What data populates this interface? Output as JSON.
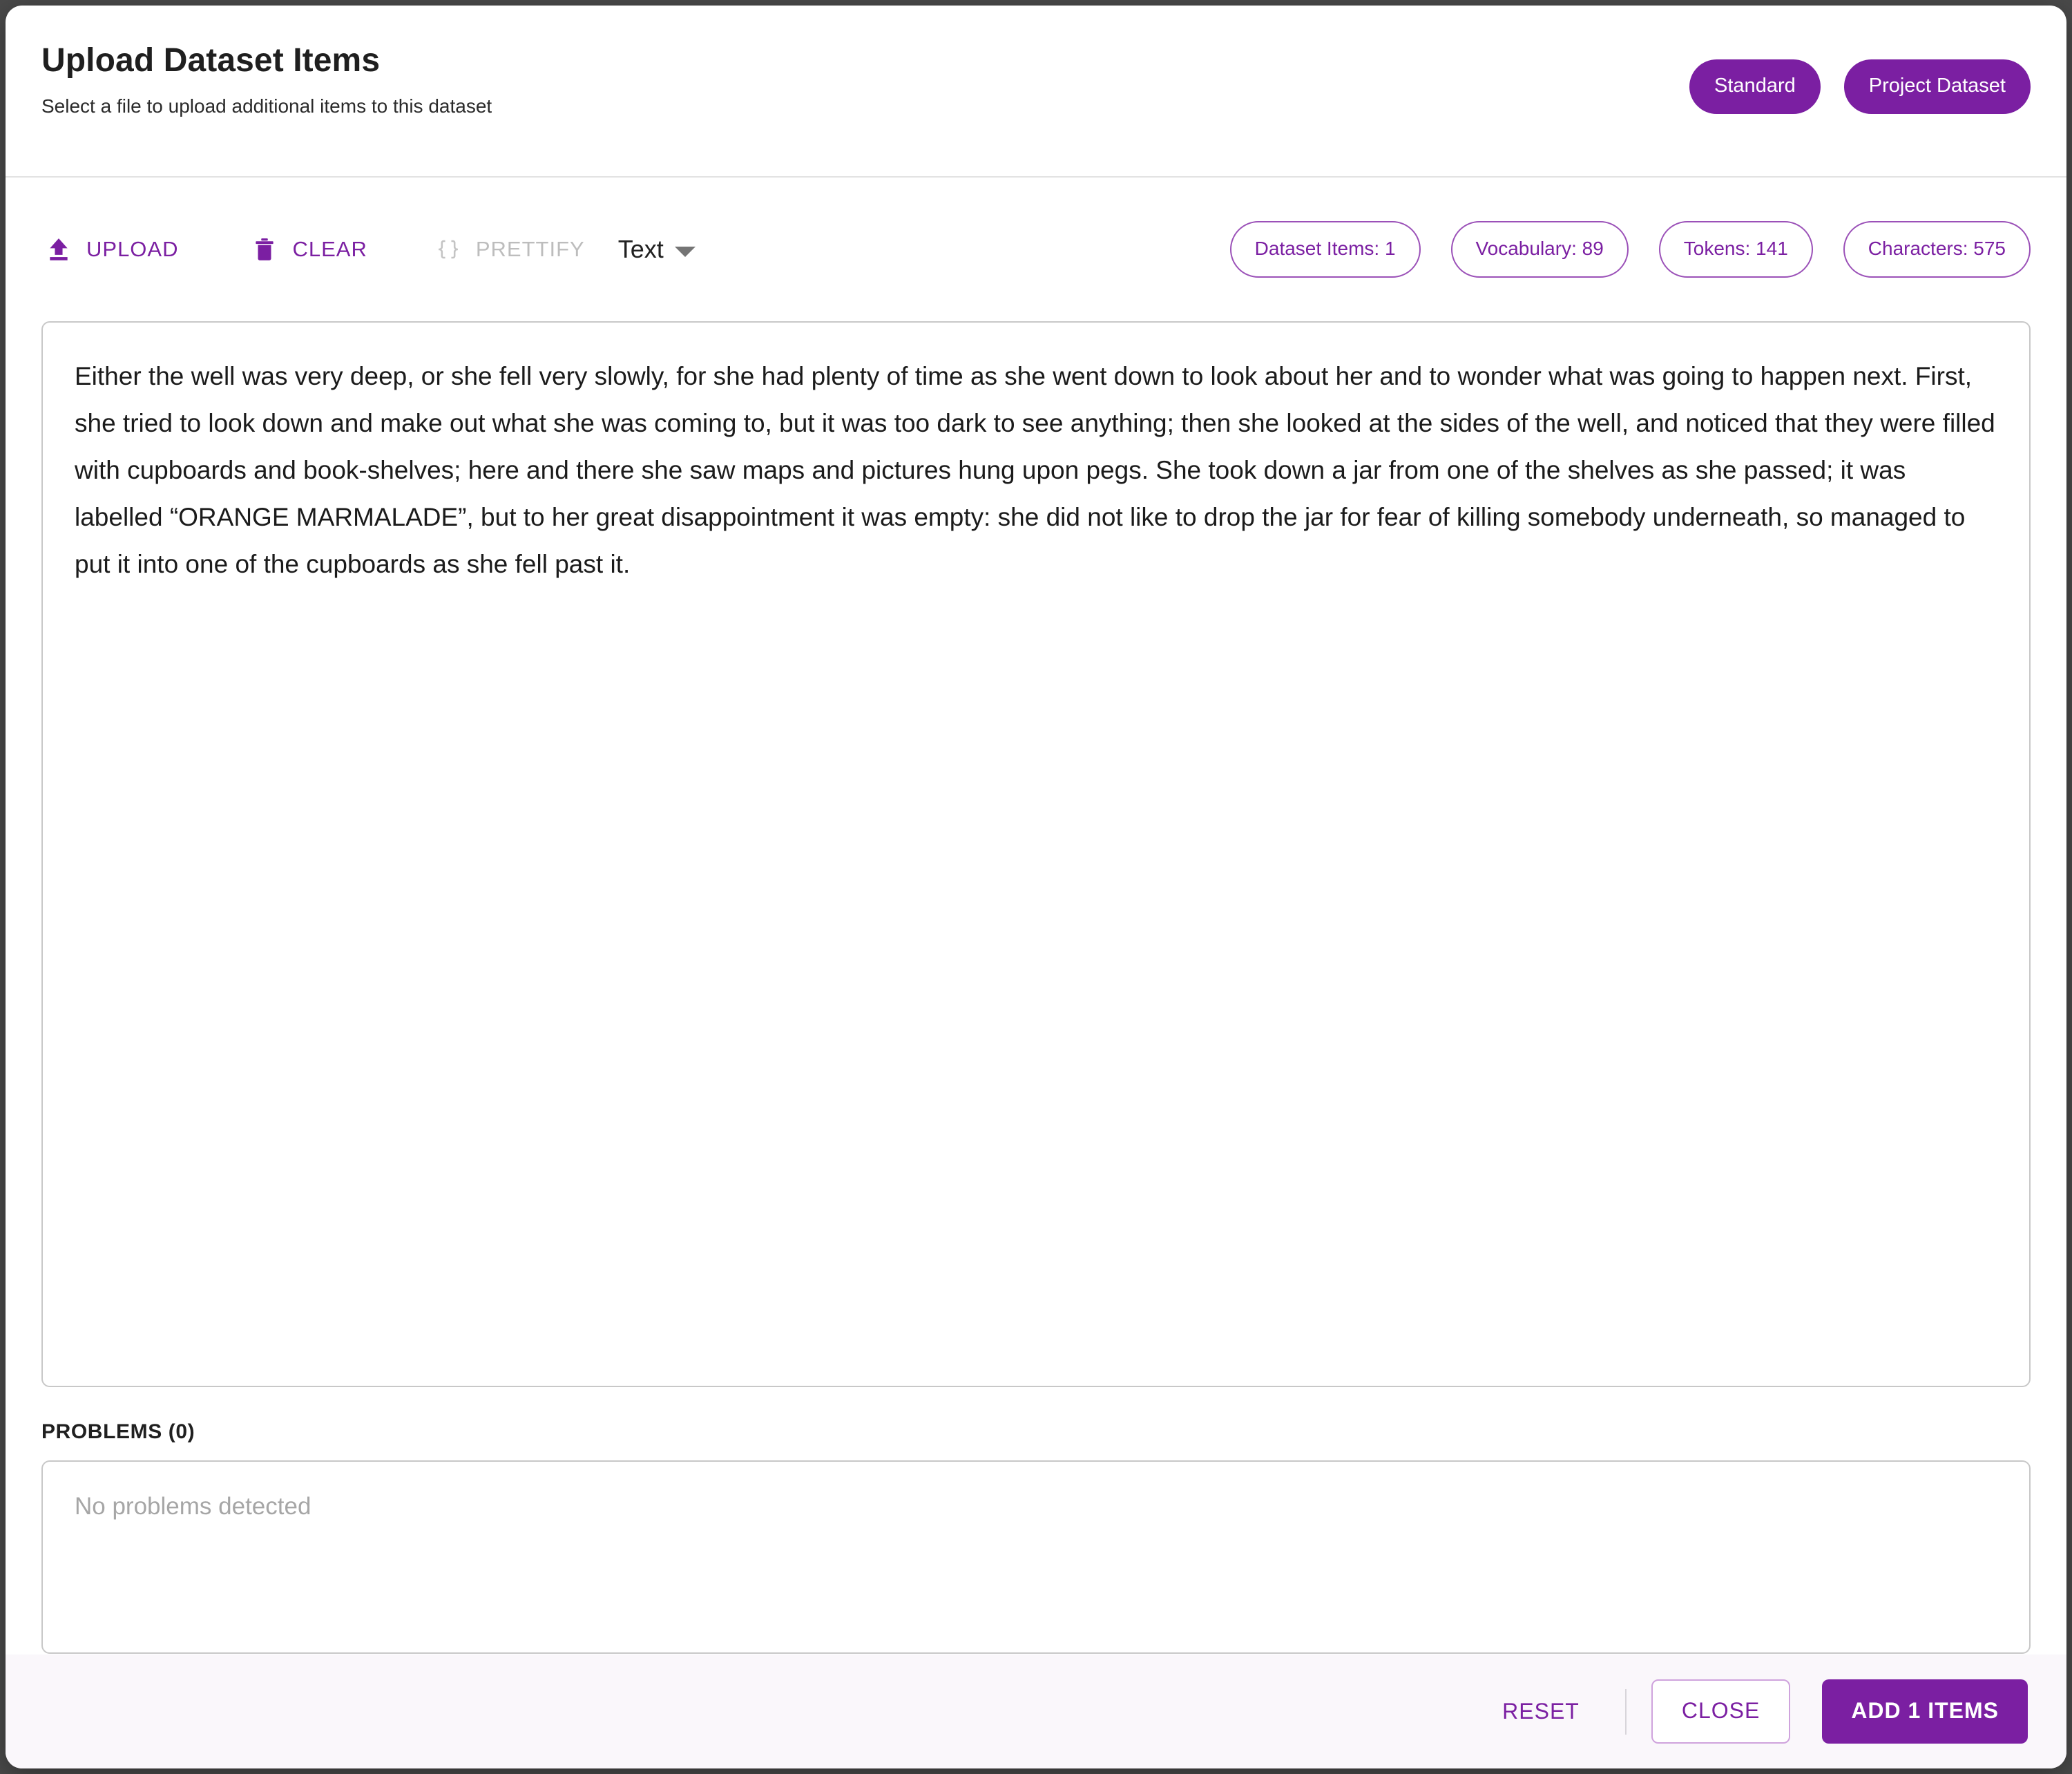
{
  "header": {
    "title": "Upload Dataset Items",
    "subtitle": "Select a file to upload additional items to this dataset",
    "chips": [
      {
        "label": "Standard",
        "name": "standard-chip"
      },
      {
        "label": "Project Dataset",
        "name": "project-dataset-chip"
      }
    ]
  },
  "toolbar": {
    "upload_label": "UPLOAD",
    "clear_label": "CLEAR",
    "prettify_label": "PRETTIFY",
    "format_value": "Text",
    "stats": [
      {
        "label": "Dataset Items: 1"
      },
      {
        "label": "Vocabulary: 89"
      },
      {
        "label": "Tokens: 141"
      },
      {
        "label": "Characters: 575"
      }
    ]
  },
  "editor": {
    "content": "Either the well was very deep, or she fell very slowly, for she had plenty of time as she went down to look about her and to wonder what was going to happen next. First, she tried to look down and make out what she was coming to, but it was too dark to see anything; then she looked at the sides of the well, and noticed that they were filled with cupboards and book-shelves; here and there she saw maps and pictures hung upon pegs. She took down a jar from one of the shelves as she passed; it was labelled “ORANGE MARMALADE”, but to her great disappointment it was empty: she did not like to drop the jar for fear of killing somebody underneath, so managed to put it into one of the cupboards as she fell past it."
  },
  "problems": {
    "heading": "PROBLEMS (0)",
    "empty_text": "No problems detected"
  },
  "footer": {
    "reset_label": "RESET",
    "close_label": "CLOSE",
    "add_label": "ADD 1 ITEMS"
  },
  "colors": {
    "accent": "#7B1FA2",
    "chip_border": "#9b51b8",
    "disabled": "#bdbdbd",
    "footer_bg": "#faf7fb"
  }
}
